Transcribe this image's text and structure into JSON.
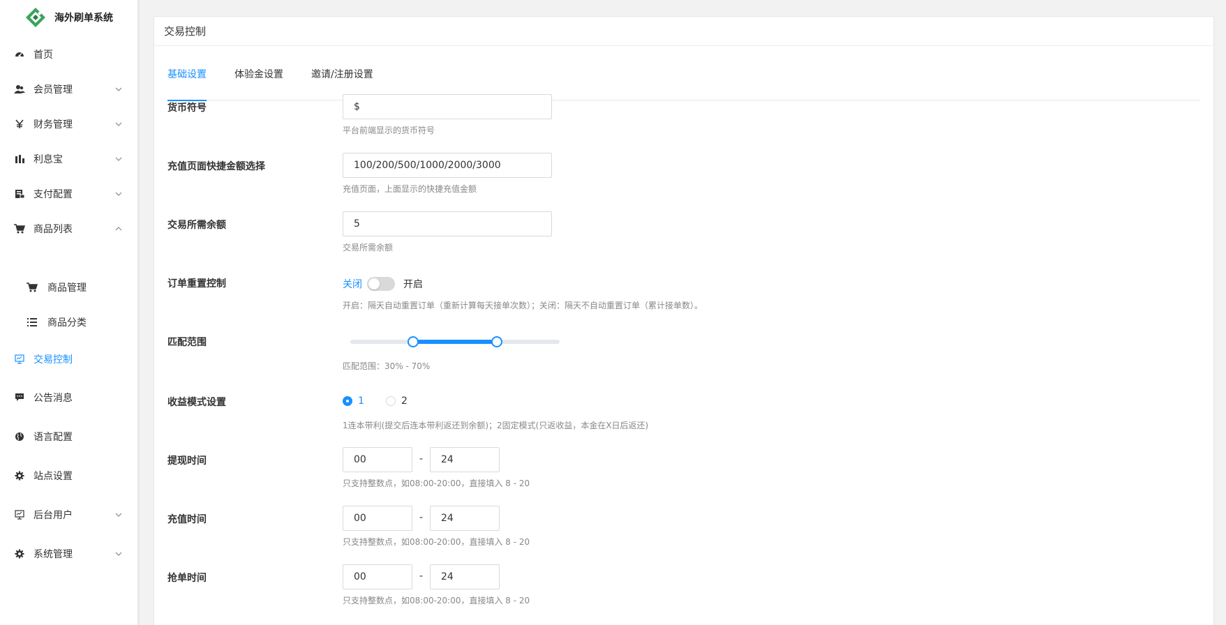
{
  "brand": {
    "name": "海外刷单系统"
  },
  "sidebar": {
    "items": [
      {
        "label": "首页",
        "icon": "dashboard-icon"
      },
      {
        "label": "会员管理",
        "icon": "users-icon"
      },
      {
        "label": "财务管理",
        "icon": "yen-icon"
      },
      {
        "label": "利息宝",
        "icon": "bar-chart-icon"
      },
      {
        "label": "支付配置",
        "icon": "payment-icon"
      },
      {
        "label": "商品列表",
        "icon": "cart-icon"
      },
      {
        "label": "商品管理",
        "icon": "cart-icon"
      },
      {
        "label": "商品分类",
        "icon": "list-icon"
      },
      {
        "label": "交易控制",
        "icon": "monitor-icon"
      },
      {
        "label": "公告消息",
        "icon": "message-icon"
      },
      {
        "label": "语言配置",
        "icon": "globe-icon"
      },
      {
        "label": "站点设置",
        "icon": "gear-icon"
      },
      {
        "label": "后台用户",
        "icon": "monitor-icon"
      },
      {
        "label": "系统管理",
        "icon": "gear-icon"
      }
    ]
  },
  "panel": {
    "title": "交易控制"
  },
  "tabs": [
    "基础设置",
    "体验金设置",
    "邀请/注册设置"
  ],
  "form": {
    "currency": {
      "label": "货币符号",
      "value": "$",
      "hint": "平台前端显示的货币符号"
    },
    "quick_amount": {
      "label": "充值页面快捷金额选择",
      "value": "100/200/500/1000/2000/3000",
      "hint": "充值页面，上面显示的快捷充值金额"
    },
    "min_balance": {
      "label": "交易所需余额",
      "value": "5",
      "hint": "交易所需余额"
    },
    "order_reset": {
      "label": "订单重置控制",
      "off_label": "关闭",
      "on_label": "开启",
      "enabled": false,
      "hint": "开启：隔天自动重置订单（重新计算每天接单次数）；关闭：隔天不自动重置订单（累计接单数）。"
    },
    "match_range": {
      "label": "匹配范围",
      "min": 30,
      "max": 70,
      "hint": "匹配范围：30% - 70%"
    },
    "profit_mode": {
      "label": "收益模式设置",
      "options": [
        "1",
        "2"
      ],
      "selected": "1",
      "hint": "1连本带利(提交后连本带利返还到余额)；2固定模式(只返收益，本金在X日后返还)"
    },
    "withdraw_time": {
      "label": "提现时间",
      "from": "00",
      "to": "24",
      "sep": "-",
      "hint": "只支持整数点，如08:00-20:00，直接填入 8 - 20"
    },
    "recharge_time": {
      "label": "充值时间",
      "from": "00",
      "to": "24",
      "sep": "-",
      "hint": "只支持整数点，如08:00-20:00，直接填入 8 - 20"
    },
    "grab_time": {
      "label": "抢单时间",
      "from": "00",
      "to": "24",
      "sep": "-",
      "hint": "只支持整数点，如08:00-20:00，直接填入 8 - 20"
    }
  },
  "colors": {
    "accent": "#1890ff",
    "sidebar_bg": "#ffffff",
    "page_bg": "#f2f2f2"
  }
}
